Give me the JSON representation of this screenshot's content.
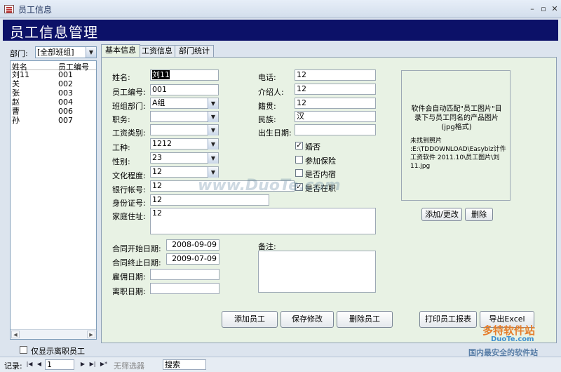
{
  "window": {
    "title": "员工信息"
  },
  "header": {
    "title": "员工信息管理"
  },
  "sidebar": {
    "dept_label": "部门:",
    "dept_value": "[全部班组]",
    "columns": [
      "姓名",
      "员工编号"
    ],
    "employees": [
      {
        "name": "刘11",
        "id": "001"
      },
      {
        "name": "关",
        "id": "002"
      },
      {
        "name": "张",
        "id": "003"
      },
      {
        "name": "赵",
        "id": "004"
      },
      {
        "name": "曹",
        "id": "006"
      },
      {
        "name": "孙",
        "id": "007"
      }
    ],
    "show_inactive_label": "仅显示离职员工"
  },
  "tabs": [
    "基本信息",
    "工资信息",
    "部门统计"
  ],
  "form": {
    "name_label": "姓名:",
    "name_value": "刘11",
    "empno_label": "员工编号:",
    "empno_value": "001",
    "team_label": "班组部门:",
    "team_value": "A组",
    "position_label": "职务:",
    "position_value": "",
    "salary_type_label": "工资类别:",
    "salary_type_value": "",
    "job_label": "工种:",
    "job_value": "1212",
    "gender_label": "性别:",
    "gender_value": "23",
    "education_label": "文化程度:",
    "education_value": "12",
    "bank_label": "银行帐号:",
    "bank_value": "12",
    "idcard_label": "身份证号:",
    "idcard_value": "12",
    "address_label": "家庭住址:",
    "address_value": "12",
    "phone_label": "电话:",
    "phone_value": "12",
    "referrer_label": "介绍人:",
    "referrer_value": "12",
    "origin_label": "籍贯:",
    "origin_value": "12",
    "ethnic_label": "民族:",
    "ethnic_value": "汉",
    "birth_label": "出生日期:",
    "birth_value": "",
    "married_label": "婚否",
    "married_checked": true,
    "insured_label": "参加保险",
    "insured_checked": false,
    "internal_label": "是否内宿",
    "internal_checked": false,
    "active_label": "是否在职",
    "active_checked": true,
    "contract_start_label": "合同开始日期:",
    "contract_start_value": "2008-09-09",
    "contract_end_label": "合同终止日期:",
    "contract_end_value": "2009-07-09",
    "hire_label": "雇佣日期:",
    "hire_value": "",
    "leave_label": "离职日期:",
    "leave_value": "",
    "remarks_label": "备注:",
    "remarks_value": ""
  },
  "photo": {
    "hint": "软件会自动匹配\"员工图片\"目录下与员工同名的产品图片(jpg格式)",
    "missing": "未找到照片\n:E:\\TDDOWNLOAD\\Easybiz计件工资软件 2011.10\\员工图片\\刘11.jpg"
  },
  "buttons": {
    "add_change_photo": "添加/更改",
    "delete_photo": "删除",
    "add_employee": "添加员工",
    "save_changes": "保存修改",
    "delete_employee": "删除员工",
    "print_report": "打印员工报表",
    "export_excel": "导出Excel"
  },
  "recnav": {
    "label": "记录:",
    "current": "1",
    "filter_label": "无筛选器",
    "search_placeholder": "搜索"
  },
  "watermark": {
    "text": "www.DuoTe.com",
    "logo": "多特软件站",
    "logo_url": "DuoTe.com",
    "logo_slogan": "国内最安全的软件站"
  }
}
